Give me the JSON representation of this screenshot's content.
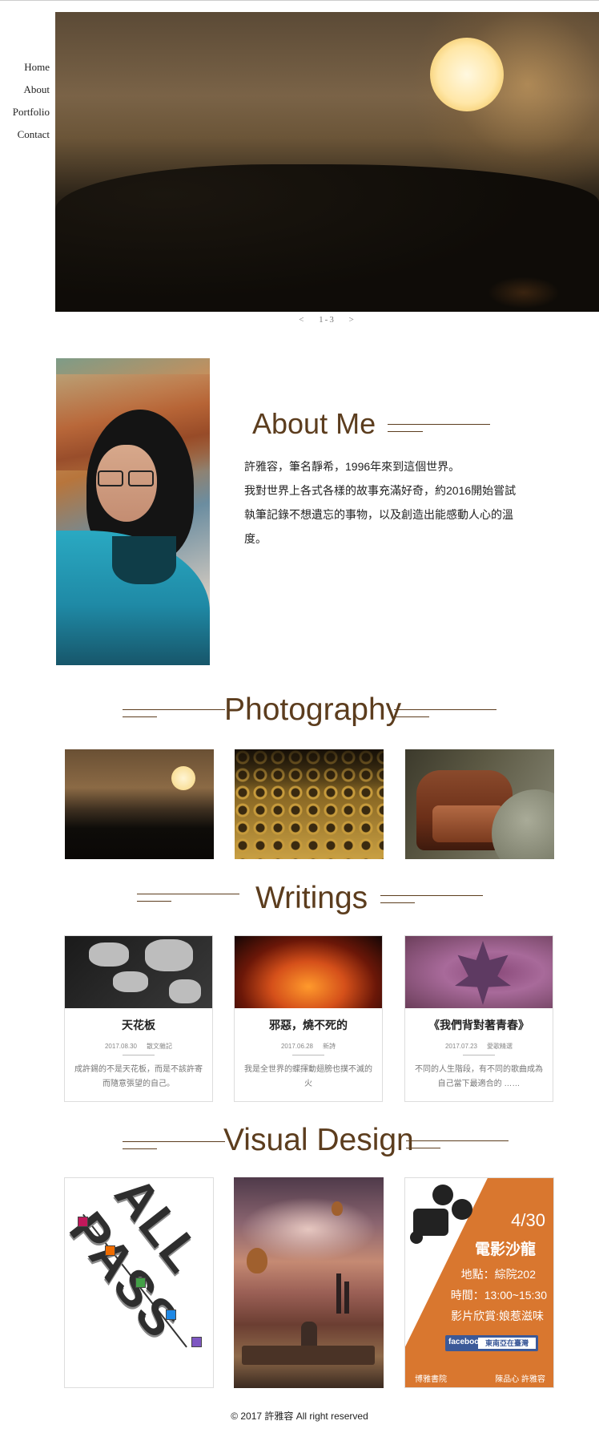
{
  "nav": {
    "items": [
      "Home",
      "About",
      "Portfolio",
      "Contact"
    ]
  },
  "hero": {
    "pager": {
      "prev": "<",
      "count": "1-3",
      "next": ">"
    }
  },
  "about": {
    "title": "About Me",
    "text_line1": "許雅容，筆名靜希，1996年來到這個世界。",
    "text_line2": "我對世界上各式各樣的故事充滿好奇，約2016開始嘗試執筆記錄不想遺忘的事物，以及創造出能感動人心的溫度。"
  },
  "photography": {
    "title": "Photography"
  },
  "writings": {
    "title": "Writings",
    "cards": [
      {
        "title": "天花板",
        "date": "2017.08.30",
        "category": "散文雜記",
        "excerpt": "成許錫的不是天花板，而是不該許寄而隨意張望的自己。"
      },
      {
        "title": "邪惡，燒不死的",
        "date": "2017.06.28",
        "category": "新詩",
        "excerpt": "我是全世界的蝶揮動翅膀也撲不滅的火"
      },
      {
        "title": "《我們背對著青春》",
        "date": "2017.07.23",
        "category": "愛歌精選",
        "excerpt": "不同的人生階段，有不同的歌曲成為自己當下最適合的 ……"
      }
    ]
  },
  "visual": {
    "title": "Visual Design",
    "poster1": {
      "word": "ALL PASS"
    },
    "poster3": {
      "date": "4/30",
      "event": "電影沙龍",
      "place": "地點：綜院202",
      "time": "時間：13:00~15:30",
      "film": "影片欣賞:娘惹滋味",
      "fb_label": "facebook",
      "fb_page": "東南亞在臺灣",
      "org_left": "博雅書院",
      "org_right": "陳品心 許雅容"
    }
  },
  "footer": {
    "text": "© 2017 許雅容 All right reserved"
  },
  "colors": {
    "accent": "#5c3d1e",
    "poster_orange": "#d9772f"
  }
}
